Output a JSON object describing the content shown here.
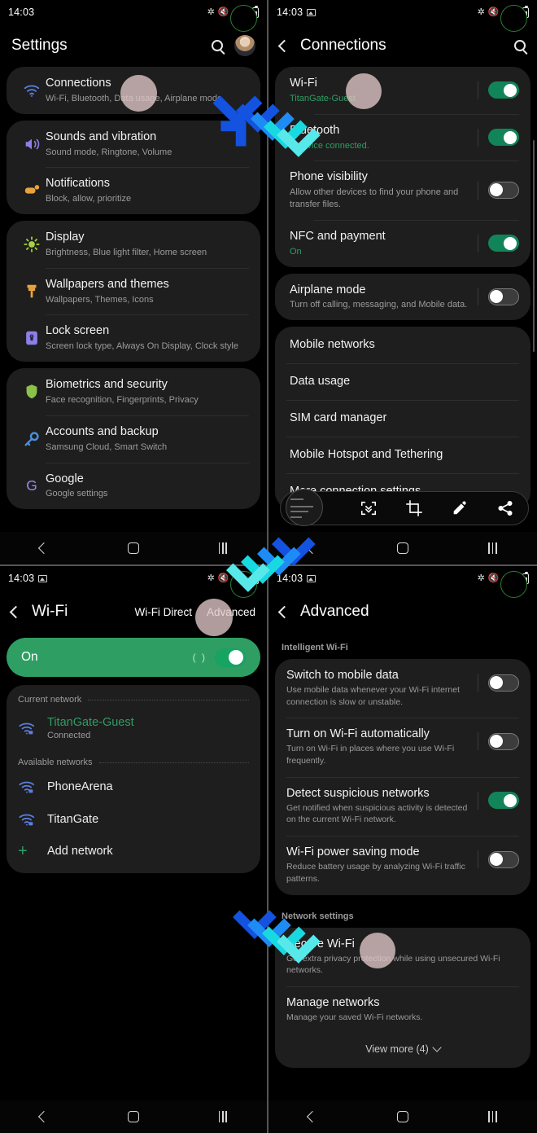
{
  "meta": {
    "status_time": "14:03",
    "accent_green": "#2f9e63",
    "toggle_on_color": "#12845a",
    "arrow_colors": [
      "#1452e0",
      "#1f8cf5",
      "#19d9e0",
      "#57e8ea"
    ]
  },
  "panels": {
    "settings": {
      "header_title": "Settings",
      "status": {
        "time": "14:03"
      },
      "groups": [
        {
          "items": [
            {
              "icon": "wifi-icon",
              "title": "Connections",
              "subtitle": "Wi-Fi, Bluetooth, Data usage, Airplane mode"
            }
          ]
        },
        {
          "items": [
            {
              "icon": "sound-icon",
              "title": "Sounds and vibration",
              "subtitle": "Sound mode, Ringtone, Volume"
            },
            {
              "icon": "notification-icon",
              "title": "Notifications",
              "subtitle": "Block, allow, prioritize"
            }
          ]
        },
        {
          "items": [
            {
              "icon": "brightness-icon",
              "title": "Display",
              "subtitle": "Brightness, Blue light filter, Home screen"
            },
            {
              "icon": "paintbrush-icon",
              "title": "Wallpapers and themes",
              "subtitle": "Wallpapers, Themes, Icons"
            },
            {
              "icon": "lock-icon",
              "title": "Lock screen",
              "subtitle": "Screen lock type, Always On Display, Clock style"
            }
          ]
        },
        {
          "items": [
            {
              "icon": "shield-icon",
              "title": "Biometrics and security",
              "subtitle": "Face recognition, Fingerprints, Privacy"
            },
            {
              "icon": "key-icon",
              "title": "Accounts and backup",
              "subtitle": "Samsung Cloud, Smart Switch"
            },
            {
              "icon": "google-icon",
              "title": "Google",
              "subtitle": "Google settings"
            }
          ]
        }
      ]
    },
    "connections": {
      "header_title": "Connections",
      "status": {
        "time": "14:03"
      },
      "groups": [
        {
          "items": [
            {
              "title": "Wi-Fi",
              "subtitle": "TitanGate-Guest",
              "subtitle_green": true,
              "toggle": "on"
            },
            {
              "title": "Bluetooth",
              "subtitle": "1 device connected.",
              "subtitle_green": true,
              "toggle": "on"
            },
            {
              "title": "Phone visibility",
              "subtitle": "Allow other devices to find your phone and transfer files.",
              "subtitle_green": false,
              "toggle": "off"
            },
            {
              "title": "NFC and payment",
              "subtitle": "On",
              "subtitle_green": true,
              "toggle": "on"
            }
          ]
        },
        {
          "items": [
            {
              "title": "Airplane mode",
              "subtitle": "Turn off calling, messaging, and Mobile data.",
              "subtitle_green": false,
              "toggle": "off"
            }
          ]
        },
        {
          "items": [
            {
              "title": "Mobile networks",
              "subtitle": "",
              "toggle": "none"
            },
            {
              "title": "Data usage",
              "subtitle": "",
              "toggle": "none"
            },
            {
              "title": "SIM card manager",
              "subtitle": "",
              "toggle": "none"
            },
            {
              "title": "Mobile Hotspot and Tethering",
              "subtitle": "",
              "toggle": "none"
            },
            {
              "title": "More connection settings",
              "subtitle": "",
              "toggle": "none"
            }
          ]
        }
      ],
      "screenshot_toolbar": {
        "buttons": [
          {
            "icon": "screenshot-thumbnail",
            "label": ""
          },
          {
            "icon": "scroll-capture-icon",
            "label": ""
          },
          {
            "icon": "crop-icon",
            "label": ""
          },
          {
            "icon": "pen-icon",
            "label": ""
          },
          {
            "icon": "share-icon",
            "label": ""
          }
        ]
      }
    },
    "wifi": {
      "header_title": "Wi-Fi",
      "status": {
        "time": "14:03"
      },
      "tabs": [
        {
          "label": "Wi-Fi Direct"
        },
        {
          "label": "Advanced"
        }
      ],
      "master_toggle": {
        "label": "On",
        "state": "on"
      },
      "sections": [
        {
          "label": "Current network",
          "networks": [
            {
              "icon": "wifi-lock-icon",
              "name": "TitanGate-Guest",
              "name_green": true,
              "status": "Connected"
            }
          ]
        },
        {
          "label": "Available networks",
          "networks": [
            {
              "icon": "wifi-lock-icon",
              "name": "PhoneArena",
              "name_green": false,
              "status": ""
            },
            {
              "icon": "wifi-lock-icon",
              "name": "TitanGate",
              "name_green": false,
              "status": ""
            },
            {
              "icon": "plus-icon",
              "name": "Add network",
              "name_green": false,
              "status": ""
            }
          ]
        }
      ]
    },
    "advanced": {
      "header_title": "Advanced",
      "status": {
        "time": "14:03"
      },
      "groups": [
        {
          "label": "Intelligent Wi-Fi",
          "items": [
            {
              "title": "Switch to mobile data",
              "subtitle": "Use mobile data whenever your Wi-Fi internet connection is slow or unstable.",
              "toggle": "off"
            },
            {
              "title": "Turn on Wi-Fi automatically",
              "subtitle": "Turn on Wi-Fi in places where you use Wi-Fi frequently.",
              "toggle": "off"
            },
            {
              "title": "Detect suspicious networks",
              "subtitle": "Get notified when suspicious activity is detected on the current Wi-Fi network.",
              "toggle": "on"
            },
            {
              "title": "Wi-Fi power saving mode",
              "subtitle": "Reduce battery usage by analyzing Wi-Fi traffic patterns.",
              "toggle": "off"
            }
          ]
        },
        {
          "label": "Network settings",
          "items": [
            {
              "title": "Secure Wi-Fi",
              "subtitle": "Get extra privacy protection while using unsecured Wi-Fi networks.",
              "toggle": "none"
            },
            {
              "title": "Manage networks",
              "subtitle": "Manage your saved Wi-Fi networks.",
              "toggle": "none"
            }
          ]
        }
      ],
      "view_more": "View more (4)"
    }
  },
  "navbar": {
    "back": "back-icon",
    "home": "home-icon",
    "recents": "recents-icon"
  }
}
